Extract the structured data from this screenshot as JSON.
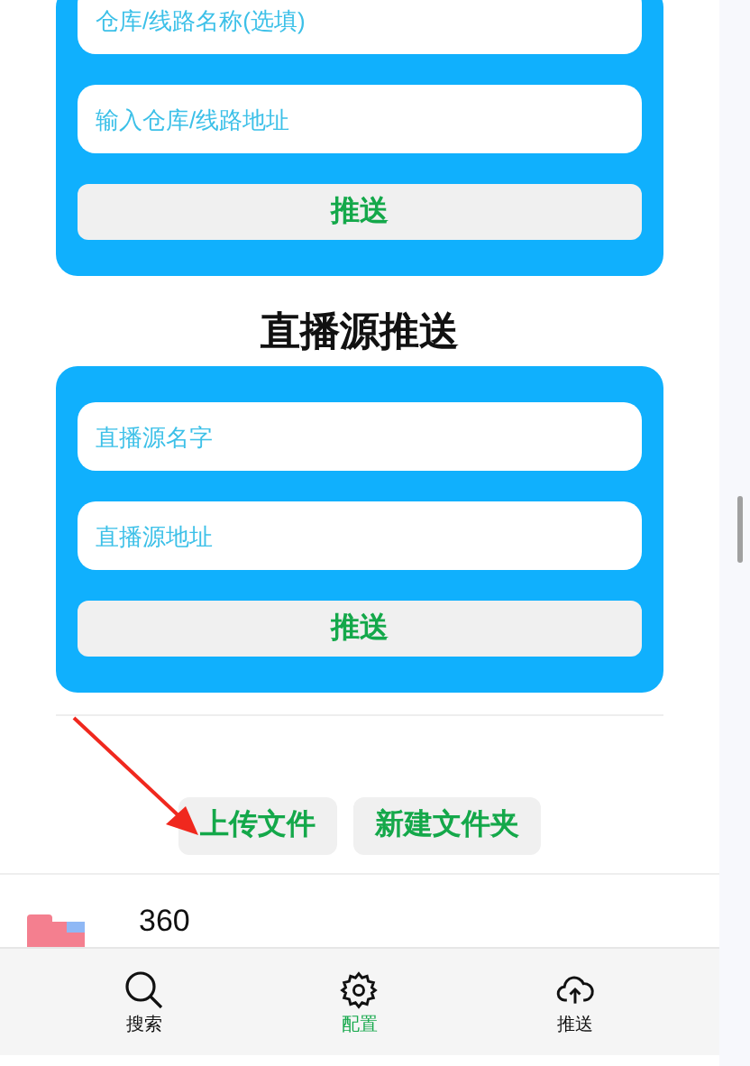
{
  "push_cards": [
    {
      "fields": [
        {
          "placeholder": "仓库/线路名称(选填)"
        },
        {
          "placeholder": "输入仓库/线路地址"
        }
      ],
      "button": "推送"
    },
    {
      "title": "直播源推送",
      "fields": [
        {
          "placeholder": "直播源名字"
        },
        {
          "placeholder": "直播源地址"
        }
      ],
      "button": "推送"
    }
  ],
  "file_actions": [
    "上传文件",
    "新建文件夹"
  ],
  "files": [
    {
      "name": "360"
    }
  ],
  "bottom_nav": [
    {
      "label": "搜索",
      "kind": "search",
      "selected": false
    },
    {
      "label": "配置",
      "kind": "settings",
      "selected": true
    },
    {
      "label": "推送",
      "kind": "upload",
      "selected": false
    }
  ]
}
